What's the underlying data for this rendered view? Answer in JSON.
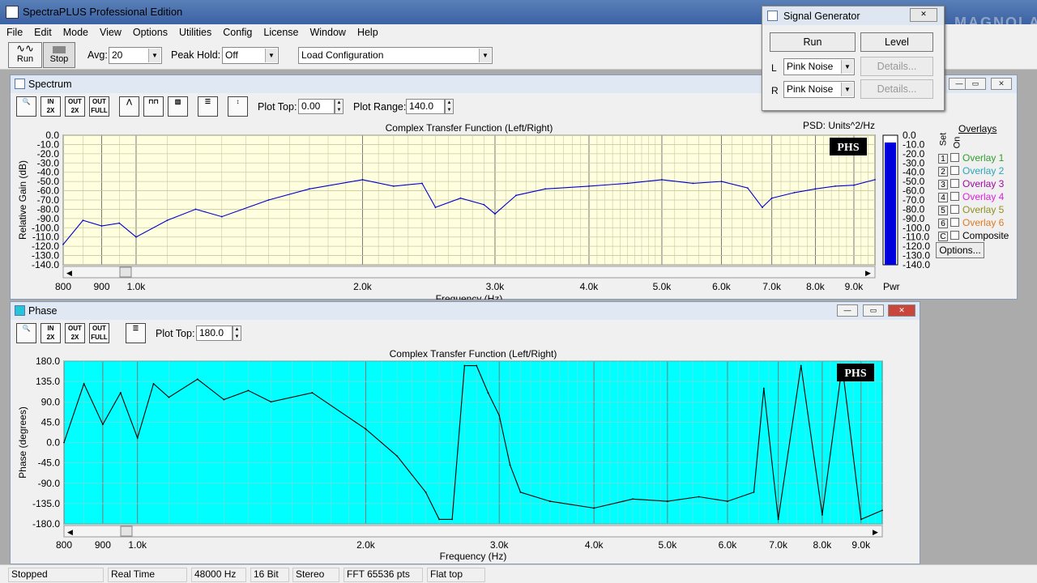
{
  "app": {
    "title": "SpectraPLUS Professional Edition"
  },
  "menu": [
    "File",
    "Edit",
    "Mode",
    "View",
    "Options",
    "Utilities",
    "Config",
    "License",
    "Window",
    "Help"
  ],
  "toolbar": {
    "run": "Run",
    "stop": "Stop",
    "avg_label": "Avg:",
    "avg_value": "20",
    "peak_label": "Peak Hold:",
    "peak_value": "Off",
    "config_value": "Load Configuration"
  },
  "spectrum": {
    "window_title": "Spectrum",
    "plot_top_label": "Plot Top:",
    "plot_top": "0.00",
    "plot_range_label": "Plot Range:",
    "plot_range": "140.0",
    "chart_title": "Complex Transfer Function (Left/Right)",
    "psd": "PSD: Units^2/Hz",
    "badge": "PHS",
    "xlabel": "Frequency (Hz)",
    "pwr": "Pwr"
  },
  "phase": {
    "window_title": "Phase",
    "plot_top_label": "Plot Top:",
    "plot_top": "180.0",
    "chart_title": "Complex Transfer Function (Left/Right)",
    "badge": "PHS",
    "xlabel": "Frequency (Hz)"
  },
  "overlays": {
    "title": "Overlays",
    "set": "Set",
    "on": "On",
    "items": [
      {
        "n": "1",
        "label": "Overlay 1",
        "color": "#2e9e2e"
      },
      {
        "n": "2",
        "label": "Overlay 2",
        "color": "#2aa6b8"
      },
      {
        "n": "3",
        "label": "Overlay 3",
        "color": "#a00aa0"
      },
      {
        "n": "4",
        "label": "Overlay 4",
        "color": "#e020e0"
      },
      {
        "n": "5",
        "label": "Overlay 5",
        "color": "#909020"
      },
      {
        "n": "6",
        "label": "Overlay 6",
        "color": "#e07a20"
      },
      {
        "n": "C",
        "label": "Composite",
        "color": "#000000"
      }
    ],
    "options": "Options..."
  },
  "siggen": {
    "title": "Signal Generator",
    "run": "Run",
    "level": "Level",
    "l": "L",
    "r": "R",
    "l_value": "Pink Noise",
    "r_value": "Pink Noise",
    "details": "Details..."
  },
  "status": [
    "Stopped",
    "Real Time",
    "48000 Hz",
    "16 Bit",
    "Stereo",
    "FFT 65536 pts",
    "Flat top"
  ],
  "watermark": "MAGNOLA",
  "chart_data": [
    {
      "type": "line",
      "title": "Complex Transfer Function (Left/Right)",
      "xlabel": "Frequency (Hz)",
      "ylabel": "Relative Gain (dB)",
      "ylim": [
        -140,
        0
      ],
      "xlim": [
        800,
        9600
      ],
      "x_scale": "log",
      "yticks": [
        "0.0",
        "-10.0",
        "-20.0",
        "-30.0",
        "-40.0",
        "-50.0",
        "-60.0",
        "-70.0",
        "-80.0",
        "-90.0",
        "-100.0",
        "-110.0",
        "-120.0",
        "-130.0",
        "-140.0"
      ],
      "xticks": [
        "800",
        "900",
        "1.0k",
        "2.0k",
        "3.0k",
        "4.0k",
        "5.0k",
        "6.0k",
        "7.0k",
        "8.0k",
        "9.0k"
      ],
      "x": [
        800,
        850,
        900,
        950,
        1000,
        1100,
        1200,
        1300,
        1500,
        1700,
        2000,
        2200,
        2400,
        2500,
        2700,
        2900,
        3000,
        3200,
        3500,
        4000,
        4500,
        5000,
        5500,
        6000,
        6500,
        6800,
        7000,
        7500,
        8000,
        8500,
        9000,
        9600
      ],
      "y": [
        -118,
        -92,
        -98,
        -95,
        -110,
        -92,
        -80,
        -88,
        -70,
        -58,
        -48,
        -55,
        -52,
        -78,
        -68,
        -75,
        -85,
        -65,
        -58,
        -55,
        -52,
        -48,
        -52,
        -50,
        -57,
        -78,
        -68,
        -62,
        -58,
        -55,
        -54,
        -48
      ]
    },
    {
      "type": "line",
      "title": "Complex Transfer Function (Left/Right)",
      "xlabel": "Frequency (Hz)",
      "ylabel": "Phase (degrees)",
      "ylim": [
        -180,
        180
      ],
      "xlim": [
        800,
        9600
      ],
      "x_scale": "log",
      "yticks": [
        "180.0",
        "135.0",
        "90.0",
        "45.0",
        "0.0",
        "-45.0",
        "-90.0",
        "-135.0",
        "-180.0"
      ],
      "xticks": [
        "800",
        "900",
        "1.0k",
        "2.0k",
        "3.0k",
        "4.0k",
        "5.0k",
        "6.0k",
        "7.0k",
        "8.0k",
        "9.0k"
      ],
      "x": [
        800,
        850,
        900,
        950,
        1000,
        1050,
        1100,
        1200,
        1300,
        1400,
        1500,
        1700,
        2000,
        2200,
        2400,
        2500,
        2600,
        2700,
        2800,
        2900,
        3000,
        3100,
        3200,
        3500,
        4000,
        4500,
        5000,
        5500,
        6000,
        6500,
        6700,
        7000,
        7500,
        8000,
        8500,
        9000,
        9600
      ],
      "y": [
        0,
        130,
        40,
        110,
        10,
        130,
        100,
        140,
        95,
        115,
        90,
        110,
        30,
        -30,
        -110,
        -170,
        -170,
        170,
        170,
        110,
        60,
        -50,
        -110,
        -130,
        -145,
        -125,
        -130,
        -120,
        -130,
        -110,
        120,
        -170,
        170,
        -160,
        170,
        -170,
        -150
      ]
    }
  ]
}
